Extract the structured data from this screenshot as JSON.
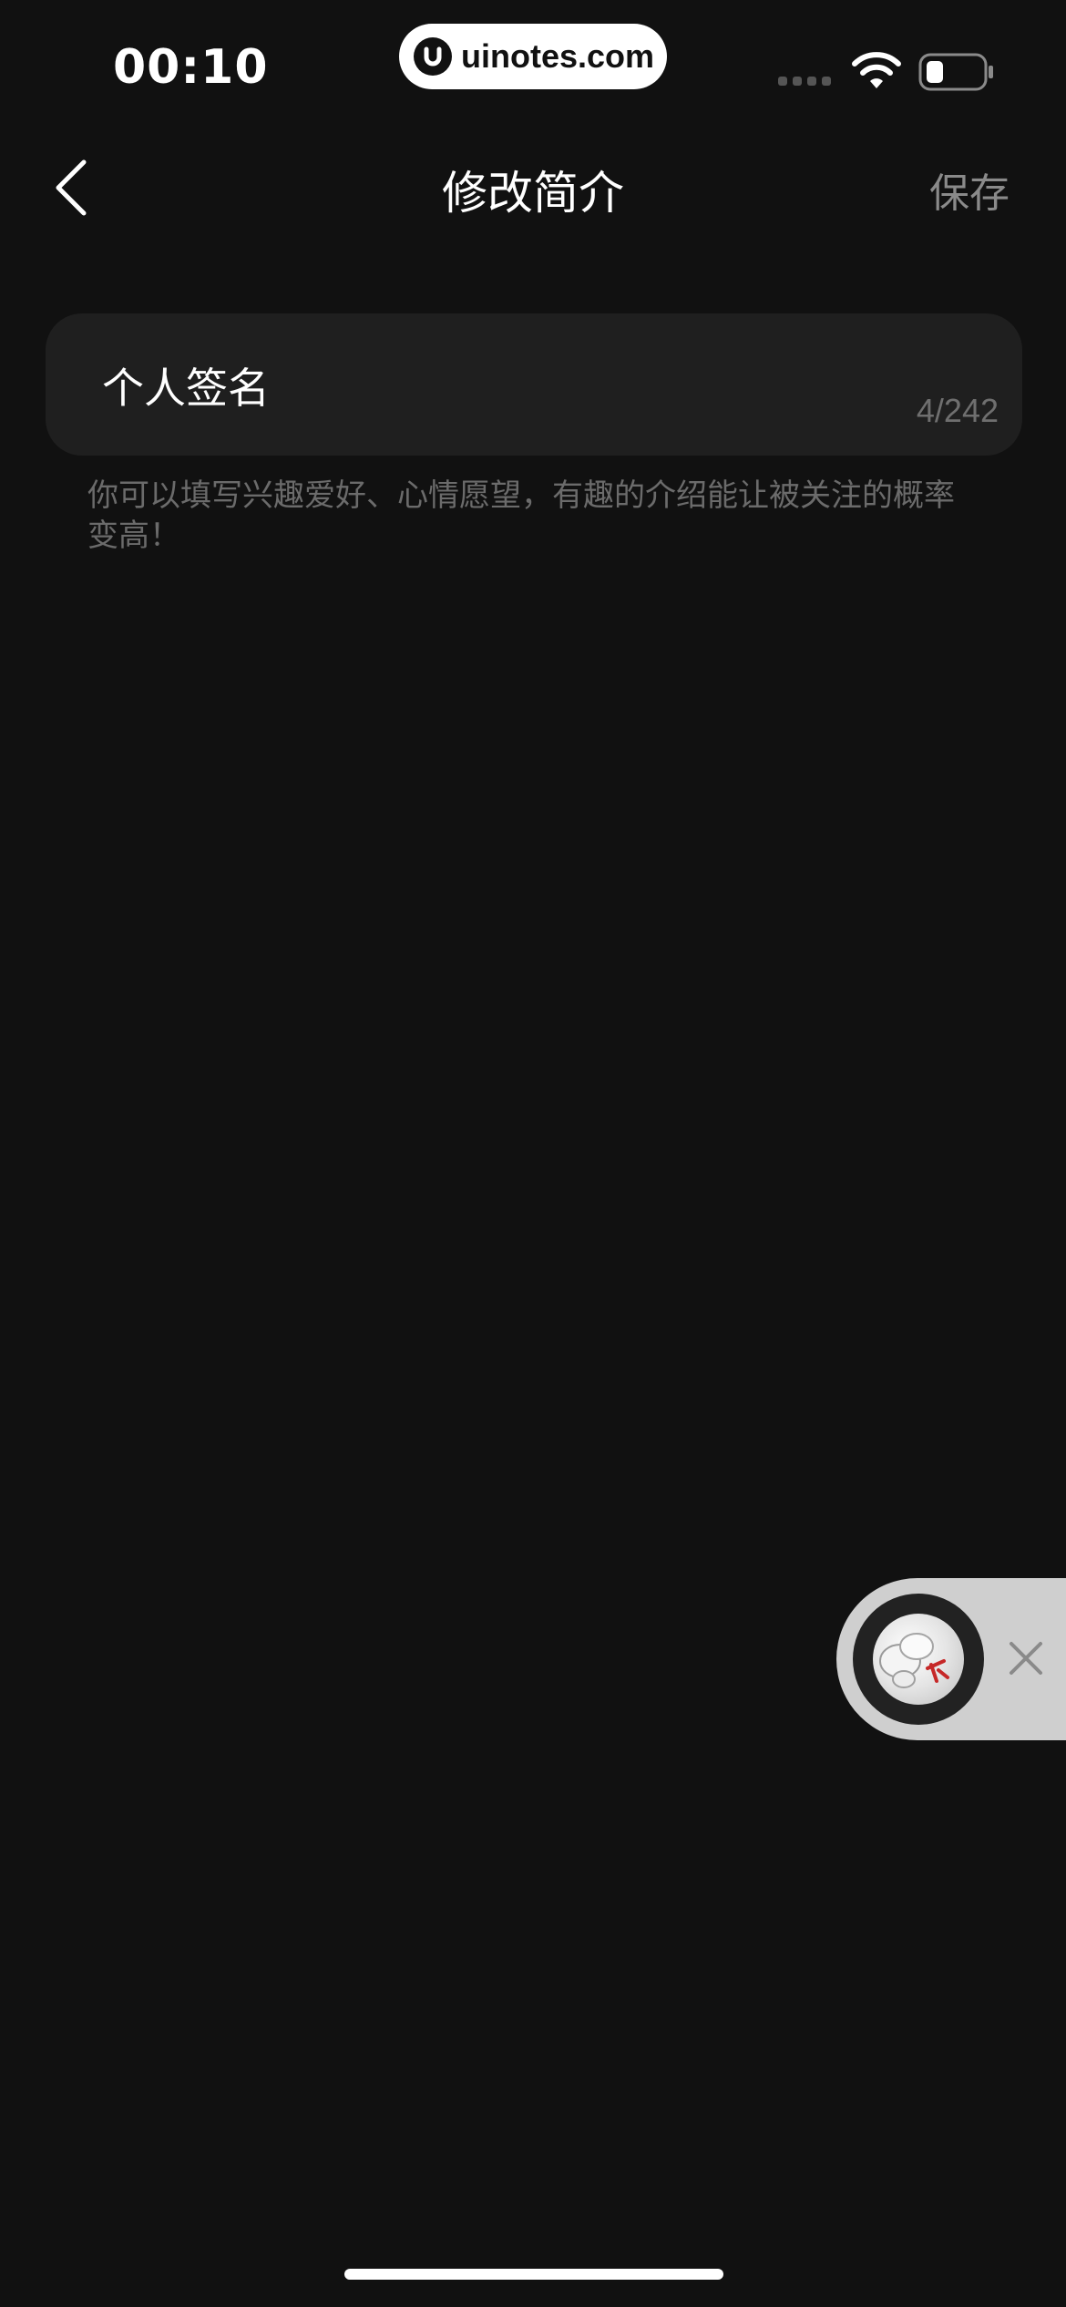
{
  "status_bar": {
    "time": "00:10",
    "watermark": "uinotes.com",
    "icons": [
      "cellular-signal-icon",
      "wifi-icon",
      "battery-icon"
    ]
  },
  "nav": {
    "back_icon": "chevron-left-icon",
    "title": "修改简介",
    "save_label": "保存"
  },
  "signature": {
    "value": "个人签名",
    "count": "4/242"
  },
  "hint": "你可以填写兴趣爱好、心情愿望，有趣的介绍能让被关注的概率变高！",
  "floating_player": {
    "close_icon": "close-icon"
  },
  "colors": {
    "background": "#111111",
    "card": "#1f1f1f",
    "muted_text": "#6b6b6b",
    "save_text": "#8a8a8a"
  }
}
